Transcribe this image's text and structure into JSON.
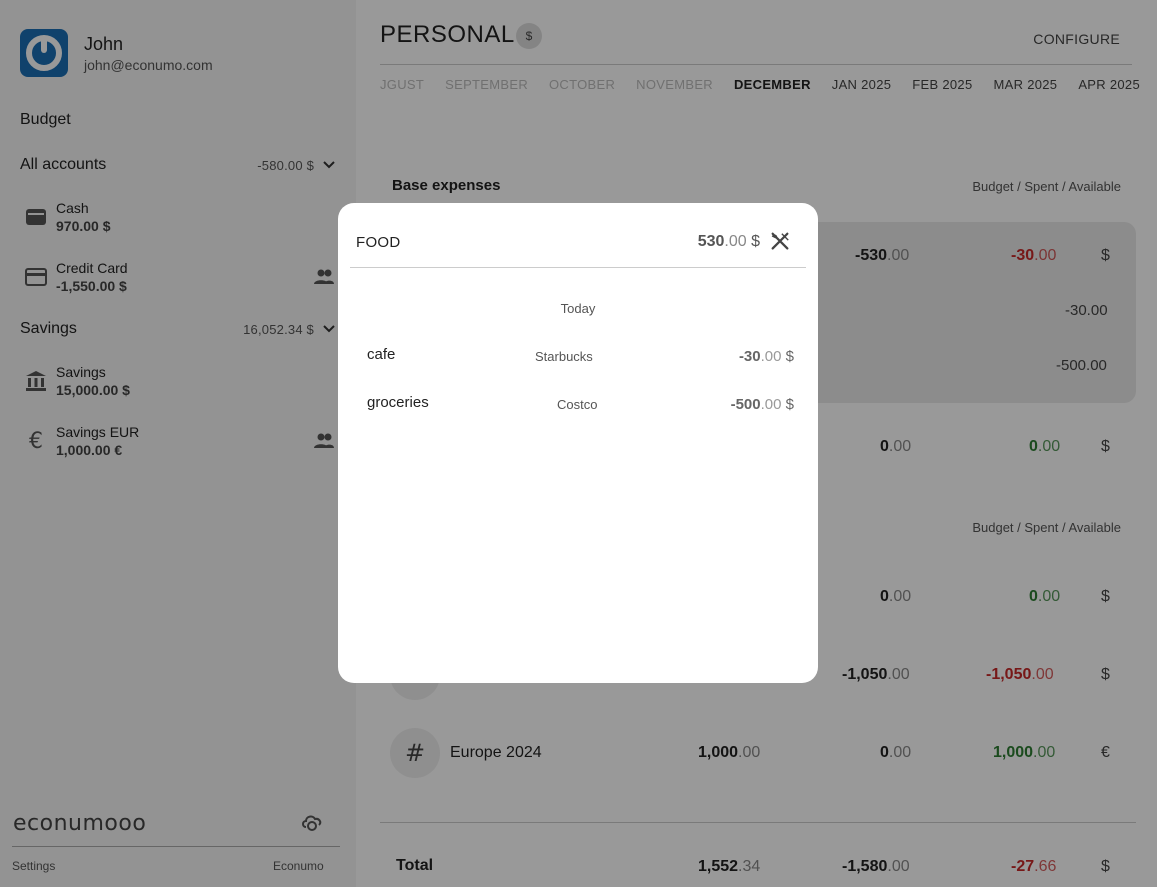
{
  "user": {
    "name": "John",
    "email": "john@econumo.com"
  },
  "sidebar": {
    "budget_label": "Budget",
    "groups": [
      {
        "name": "All accounts",
        "total": "-580.00 $",
        "accounts": [
          {
            "name": "Cash",
            "balance": "970.00 $",
            "icon": "wallet-icon",
            "shared": false
          },
          {
            "name": "Credit Card",
            "balance": "-1,550.00 $",
            "icon": "credit-card-icon",
            "shared": true
          }
        ]
      },
      {
        "name": "Savings",
        "total": "16,052.34 $",
        "accounts": [
          {
            "name": "Savings",
            "balance": "15,000.00 $",
            "icon": "bank-icon",
            "shared": false
          },
          {
            "name": "Savings EUR",
            "balance": "1,000.00 €",
            "icon": "euro-icon",
            "shared": true
          }
        ]
      }
    ],
    "logo": "econumooo",
    "footer": {
      "settings": "Settings",
      "brand": "Econumo"
    }
  },
  "header": {
    "title": "PERSONAL",
    "currency_badge": "$",
    "configure_label": "CONFIGURE",
    "months": [
      "JGUST",
      "SEPTEMBER",
      "OCTOBER",
      "NOVEMBER",
      "DECEMBER",
      "JAN 2025",
      "FEB 2025",
      "MAR 2025",
      "APR 2025"
    ],
    "current_month": "DECEMBER"
  },
  "budget": {
    "section1_title": "Base expenses",
    "columns_hint": "Budget / Spent / Available",
    "food_row": {
      "spent_int": "-530",
      "spent_dec": ".00",
      "available_int": "-30",
      "available_dec": ".00",
      "currency": "$",
      "sub1": "-30.00",
      "sub2": "-500.00"
    },
    "row2": {
      "spent_int": "0",
      "spent_dec": ".00",
      "available_int": "0",
      "available_dec": ".00",
      "currency": "$"
    },
    "section2_hint": "Budget / Spent / Available",
    "row3": {
      "spent_int": "0",
      "spent_dec": ".00",
      "available_int": "0",
      "available_dec": ".00",
      "currency": "$"
    },
    "row4": {
      "spent_int": "-1,050",
      "spent_dec": ".00",
      "available_int": "-1,050",
      "available_dec": ".00",
      "currency": "$"
    },
    "europe_row": {
      "label": "Europe 2024",
      "budget_int": "1,000",
      "budget_dec": ".00",
      "spent_int": "0",
      "spent_dec": ".00",
      "available_int": "1,000",
      "available_dec": ".00",
      "currency": "€"
    },
    "total_row": {
      "label": "Total",
      "budget_int": "1,552",
      "budget_dec": ".34",
      "spent_int": "-1,580",
      "spent_dec": ".00",
      "available_int": "-27",
      "available_dec": ".66",
      "currency": "$"
    }
  },
  "modal": {
    "title": "FOOD",
    "amount_int": "530",
    "amount_dec": ".00",
    "amount_currency": " $",
    "icon": "fork-knife-icon",
    "day_label": "Today",
    "transactions": [
      {
        "name": "cafe",
        "payee": "Starbucks",
        "amount_int": "-30",
        "amount_dec": ".00",
        "currency": " $"
      },
      {
        "name": "groceries",
        "payee": "Costco",
        "amount_int": "-500",
        "amount_dec": ".00",
        "currency": " $"
      }
    ]
  }
}
